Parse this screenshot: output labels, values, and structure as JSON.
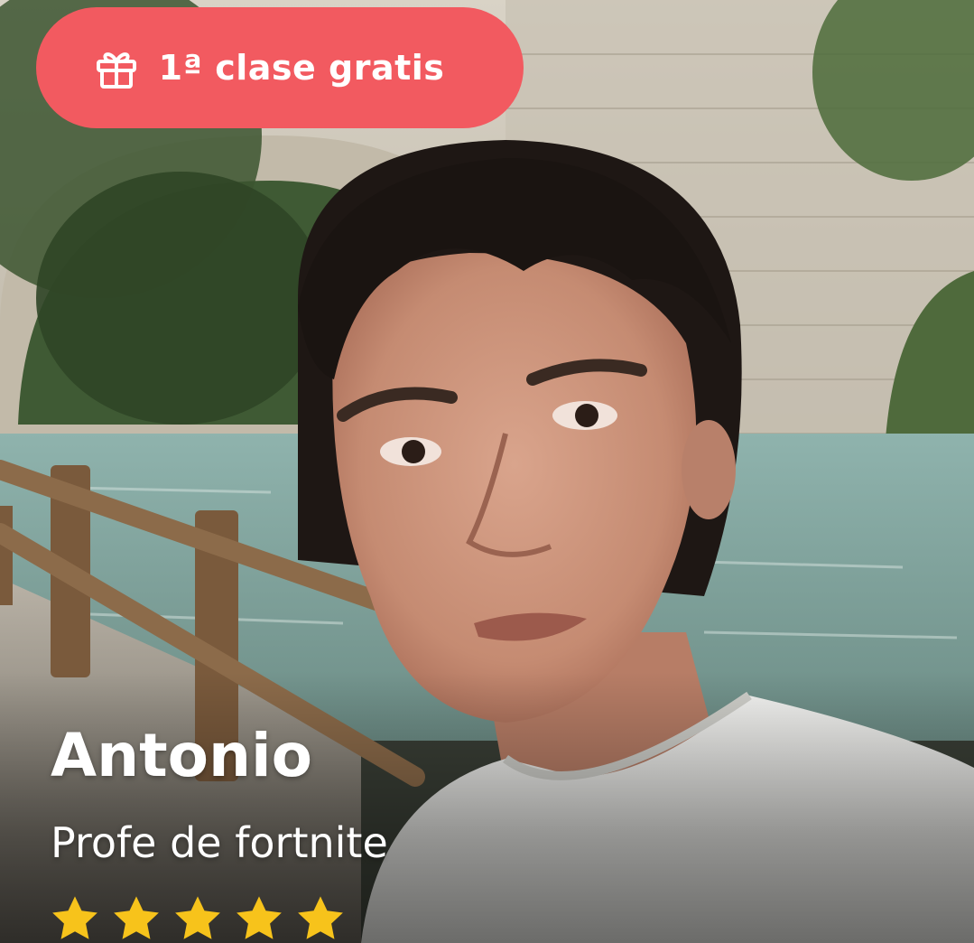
{
  "promo": {
    "label": "1ª clase gratis",
    "icon": "gift-icon",
    "color": "#f25a60"
  },
  "teacher": {
    "name": "Antonio",
    "subject": "Profe de fortnite",
    "rating_stars": 5,
    "rating_max": 5,
    "star_color": "#f7c31b"
  },
  "photo": {
    "icon": "profile-photo"
  }
}
